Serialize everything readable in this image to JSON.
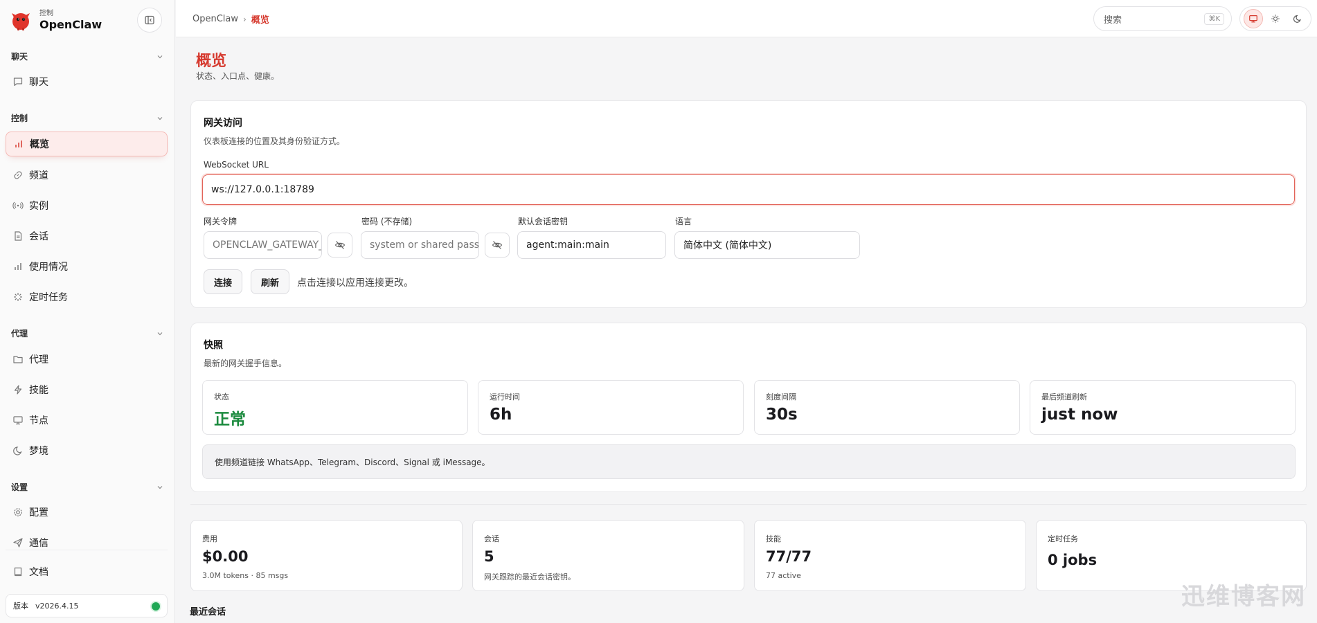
{
  "sidebar": {
    "brand_sub": "控制",
    "brand_name": "OpenClaw",
    "sections": {
      "chat": "聊天",
      "control": "控制",
      "agent": "代理",
      "settings": "设置"
    },
    "items": {
      "chat": "聊天",
      "overview": "概览",
      "channels": "频道",
      "instances": "实例",
      "sessions": "会话",
      "usage": "使用情况",
      "cron": "定时任务",
      "agents": "代理",
      "skills": "技能",
      "nodes": "节点",
      "dreams": "梦境",
      "config": "配置",
      "comms": "通信",
      "docs": "文档"
    },
    "version_label": "版本",
    "version_value": "v2026.4.15"
  },
  "topbar": {
    "breadcrumb_root": "OpenClaw",
    "breadcrumb_sep": "›",
    "breadcrumb_current": "概览",
    "search_placeholder": "搜索",
    "search_shortcut": "⌘K"
  },
  "page": {
    "title": "概览",
    "subtitle": "状态、入口点、健康。"
  },
  "gateway": {
    "title": "网关访问",
    "subtitle": "仪表板连接的位置及其身份验证方式。",
    "ws_label": "WebSocket URL",
    "ws_value": "ws://127.0.0.1:18789",
    "token_label": "网关令牌",
    "token_placeholder": "OPENCLAW_GATEWAY_TOKEN",
    "password_label": "密码 (不存储)",
    "password_placeholder": "system or shared password",
    "session_key_label": "默认会话密钥",
    "session_key_value": "agent:main:main",
    "language_label": "语言",
    "language_value": "简体中文 (简体中文)",
    "connect_button": "连接",
    "refresh_button": "刷新",
    "hint": "点击连接以应用连接更改。"
  },
  "snapshot": {
    "title": "快照",
    "subtitle": "最新的网关握手信息。",
    "stats": [
      {
        "label": "状态",
        "value": "正常"
      },
      {
        "label": "运行时间",
        "value": "6h"
      },
      {
        "label": "刻度间隔",
        "value": "30s"
      },
      {
        "label": "最后频道刷新",
        "value": "just now"
      }
    ],
    "info": "使用频道链接 WhatsApp、Telegram、Discord、Signal 或 iMessage。"
  },
  "metrics": [
    {
      "label": "费用",
      "value": "$0.00",
      "sub": "3.0M tokens · 85 msgs"
    },
    {
      "label": "会话",
      "value": "5",
      "sub": "网关跟踪的最近会话密钥。"
    },
    {
      "label": "技能",
      "value": "77/77",
      "sub": "77 active"
    },
    {
      "label": "定时任务",
      "value": "0 jobs",
      "sub": ""
    }
  ],
  "recent_sessions_heading": "最近会话",
  "watermark": "迅维博客网",
  "colors": {
    "accent": "#d63a2f",
    "ok": "#1b8a3e",
    "online_dot": "#1fa855"
  }
}
